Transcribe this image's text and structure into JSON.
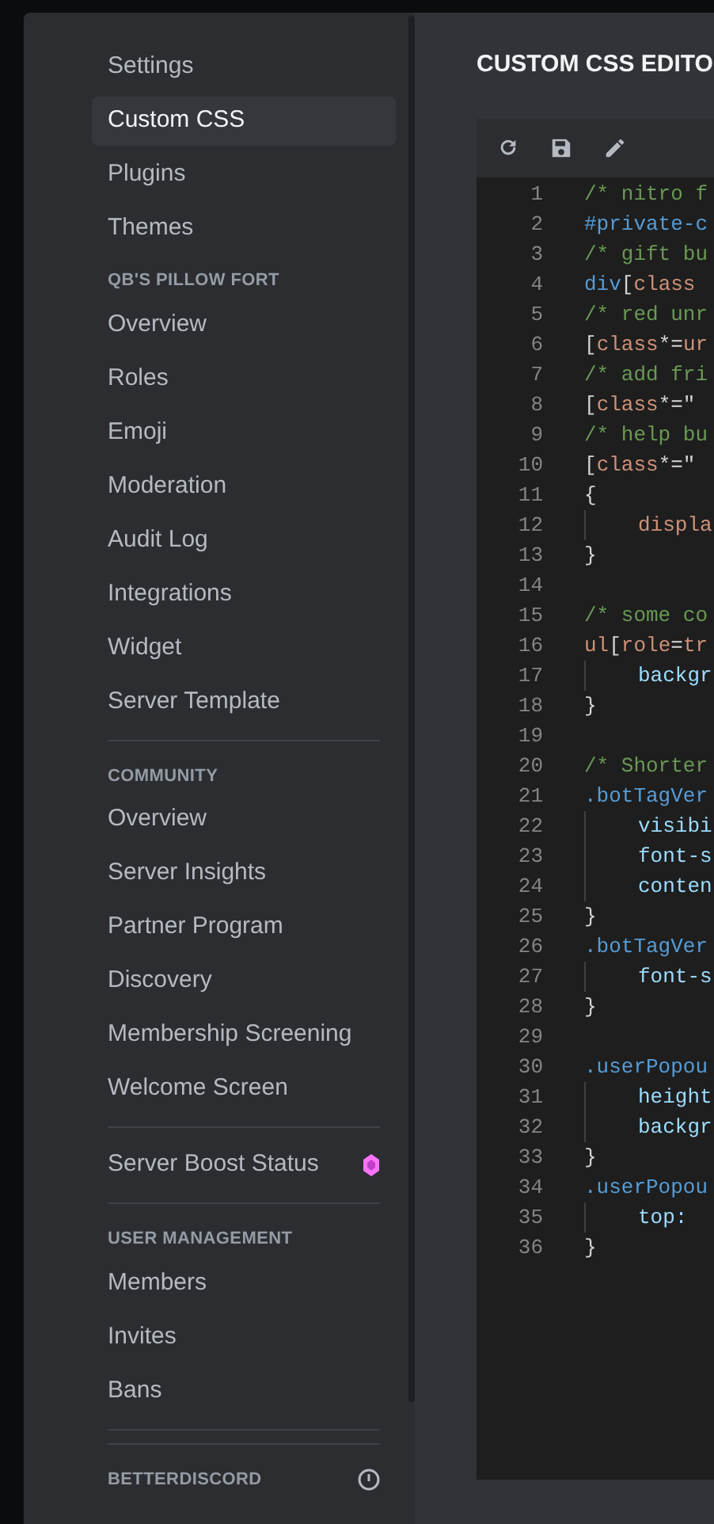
{
  "sidebar": {
    "items": [
      {
        "kind": "item",
        "label": "Settings",
        "selected": false
      },
      {
        "kind": "item",
        "label": "Custom CSS",
        "selected": true
      },
      {
        "kind": "item",
        "label": "Plugins",
        "selected": false
      },
      {
        "kind": "item",
        "label": "Themes",
        "selected": false
      },
      {
        "kind": "header",
        "label": "QB'S PILLOW FORT"
      },
      {
        "kind": "item",
        "label": "Overview",
        "selected": false
      },
      {
        "kind": "item",
        "label": "Roles",
        "selected": false
      },
      {
        "kind": "item",
        "label": "Emoji",
        "selected": false
      },
      {
        "kind": "item",
        "label": "Moderation",
        "selected": false
      },
      {
        "kind": "item",
        "label": "Audit Log",
        "selected": false
      },
      {
        "kind": "item",
        "label": "Integrations",
        "selected": false
      },
      {
        "kind": "item",
        "label": "Widget",
        "selected": false
      },
      {
        "kind": "item",
        "label": "Server Template",
        "selected": false
      },
      {
        "kind": "divider"
      },
      {
        "kind": "header",
        "label": "COMMUNITY"
      },
      {
        "kind": "item",
        "label": "Overview",
        "selected": false
      },
      {
        "kind": "item",
        "label": "Server Insights",
        "selected": false
      },
      {
        "kind": "item",
        "label": "Partner Program",
        "selected": false
      },
      {
        "kind": "item",
        "label": "Discovery",
        "selected": false
      },
      {
        "kind": "item",
        "label": "Membership Screening",
        "selected": false
      },
      {
        "kind": "item",
        "label": "Welcome Screen",
        "selected": false
      },
      {
        "kind": "divider"
      },
      {
        "kind": "item",
        "label": "Server Boost Status",
        "selected": false,
        "boost": true
      },
      {
        "kind": "divider"
      },
      {
        "kind": "header",
        "label": "USER MANAGEMENT"
      },
      {
        "kind": "item",
        "label": "Members",
        "selected": false
      },
      {
        "kind": "item",
        "label": "Invites",
        "selected": false
      },
      {
        "kind": "item",
        "label": "Bans",
        "selected": false
      },
      {
        "kind": "divider"
      },
      {
        "kind": "divider"
      },
      {
        "kind": "header",
        "label": "BETTERDISCORD",
        "info": true
      }
    ]
  },
  "editor": {
    "title": "CUSTOM CSS EDITO",
    "lines": [
      {
        "number": "1",
        "tokens": [
          {
            "kind": "comment",
            "text": "/* nitro f"
          }
        ]
      },
      {
        "number": "2",
        "tokens": [
          {
            "kind": "selector",
            "text": "#private-c"
          }
        ]
      },
      {
        "number": "3",
        "tokens": [
          {
            "kind": "comment",
            "text": "/* gift bu"
          }
        ]
      },
      {
        "number": "4",
        "tokens": [
          {
            "kind": "selector",
            "text": "div"
          },
          {
            "kind": "punct",
            "text": "["
          },
          {
            "kind": "attr",
            "text": "class"
          }
        ]
      },
      {
        "number": "5",
        "tokens": [
          {
            "kind": "comment",
            "text": "/* red unr"
          }
        ]
      },
      {
        "number": "6",
        "tokens": [
          {
            "kind": "punct",
            "text": "["
          },
          {
            "kind": "attr",
            "text": "class"
          },
          {
            "kind": "punct",
            "text": "*="
          },
          {
            "kind": "attr",
            "text": "ur"
          }
        ]
      },
      {
        "number": "7",
        "tokens": [
          {
            "kind": "comment",
            "text": "/* add fri"
          }
        ]
      },
      {
        "number": "8",
        "tokens": [
          {
            "kind": "punct",
            "text": "["
          },
          {
            "kind": "attr",
            "text": "class"
          },
          {
            "kind": "punct",
            "text": "*=\""
          }
        ]
      },
      {
        "number": "9",
        "tokens": [
          {
            "kind": "comment",
            "text": "/* help bu"
          }
        ]
      },
      {
        "number": "10",
        "tokens": [
          {
            "kind": "punct",
            "text": "["
          },
          {
            "kind": "attr",
            "text": "class"
          },
          {
            "kind": "punct",
            "text": "*=\""
          }
        ]
      },
      {
        "number": "11",
        "tokens": [
          {
            "kind": "punct",
            "text": "{"
          }
        ]
      },
      {
        "number": "12",
        "indent": true,
        "tokens": [
          {
            "kind": "attr",
            "text": "displa"
          }
        ]
      },
      {
        "number": "13",
        "tokens": [
          {
            "kind": "punct",
            "text": "}"
          }
        ]
      },
      {
        "number": "14"
      },
      {
        "number": "15",
        "tokens": [
          {
            "kind": "comment",
            "text": "/* some co"
          }
        ]
      },
      {
        "number": "16",
        "tokens": [
          {
            "kind": "attr",
            "text": "ul"
          },
          {
            "kind": "punct",
            "text": "["
          },
          {
            "kind": "attr",
            "text": "role"
          },
          {
            "kind": "punct",
            "text": "="
          },
          {
            "kind": "attr",
            "text": "tr"
          }
        ]
      },
      {
        "number": "17",
        "indent": true,
        "tokens": [
          {
            "kind": "prop",
            "text": "backgr"
          }
        ]
      },
      {
        "number": "18",
        "tokens": [
          {
            "kind": "punct",
            "text": "}"
          }
        ]
      },
      {
        "number": "19"
      },
      {
        "number": "20",
        "tokens": [
          {
            "kind": "comment",
            "text": "/* Shorter"
          }
        ]
      },
      {
        "number": "21",
        "tokens": [
          {
            "kind": "selector",
            "text": ".botTagVer"
          }
        ]
      },
      {
        "number": "22",
        "indent": true,
        "tokens": [
          {
            "kind": "prop",
            "text": "visibi"
          }
        ]
      },
      {
        "number": "23",
        "indent": true,
        "tokens": [
          {
            "kind": "prop",
            "text": "font-s"
          }
        ]
      },
      {
        "number": "24",
        "indent": true,
        "tokens": [
          {
            "kind": "prop",
            "text": "conten"
          }
        ]
      },
      {
        "number": "25",
        "tokens": [
          {
            "kind": "punct",
            "text": "}"
          }
        ]
      },
      {
        "number": "26",
        "tokens": [
          {
            "kind": "selector",
            "text": ".botTagVer"
          }
        ]
      },
      {
        "number": "27",
        "indent": true,
        "tokens": [
          {
            "kind": "prop",
            "text": "font-s"
          }
        ]
      },
      {
        "number": "28",
        "tokens": [
          {
            "kind": "punct",
            "text": "}"
          }
        ]
      },
      {
        "number": "29"
      },
      {
        "number": "30",
        "tokens": [
          {
            "kind": "selector",
            "text": ".userPopou"
          }
        ]
      },
      {
        "number": "31",
        "indent": true,
        "tokens": [
          {
            "kind": "prop",
            "text": "height"
          }
        ]
      },
      {
        "number": "32",
        "indent": true,
        "tokens": [
          {
            "kind": "prop",
            "text": "backgr"
          }
        ]
      },
      {
        "number": "33",
        "tokens": [
          {
            "kind": "punct",
            "text": "}"
          }
        ]
      },
      {
        "number": "34",
        "tokens": [
          {
            "kind": "selector",
            "text": ".userPopou"
          }
        ]
      },
      {
        "number": "35",
        "indent": true,
        "tokens": [
          {
            "kind": "prop",
            "text": "top:"
          }
        ]
      },
      {
        "number": "36",
        "tokens": [
          {
            "kind": "punct",
            "text": "}"
          }
        ]
      }
    ]
  }
}
